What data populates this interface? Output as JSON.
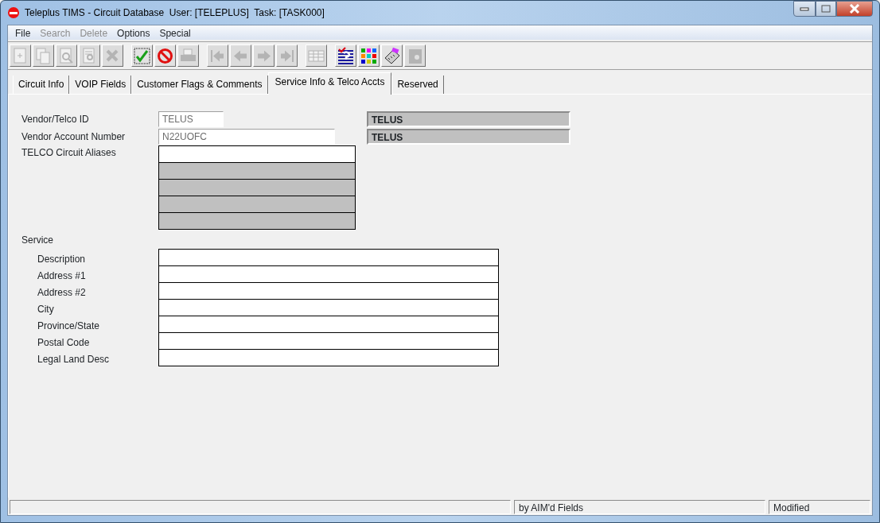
{
  "window": {
    "title": "Teleplus TIMS - Circuit Database  User: [TELEPLUS]  Task: [TASK000]"
  },
  "menu": [
    {
      "label": "File",
      "disabled": false
    },
    {
      "label": "Search",
      "disabled": true
    },
    {
      "label": "Delete",
      "disabled": true
    },
    {
      "label": "Options",
      "disabled": false
    },
    {
      "label": "Special",
      "disabled": false
    }
  ],
  "toolbar": [
    [
      {
        "kind": "new",
        "disabled": true
      },
      {
        "kind": "copy",
        "disabled": true
      },
      {
        "kind": "find",
        "disabled": true
      },
      {
        "kind": "find-doc",
        "disabled": true
      },
      {
        "kind": "delete",
        "disabled": true
      }
    ],
    [
      {
        "kind": "save",
        "disabled": false
      },
      {
        "kind": "cancel",
        "disabled": false
      },
      {
        "kind": "print",
        "disabled": true
      }
    ],
    [
      {
        "kind": "first",
        "disabled": true
      },
      {
        "kind": "prev",
        "disabled": true
      },
      {
        "kind": "next",
        "disabled": true
      },
      {
        "kind": "last",
        "disabled": true
      }
    ],
    [
      {
        "kind": "table",
        "disabled": true
      }
    ],
    [
      {
        "kind": "help",
        "disabled": false
      },
      {
        "kind": "grid",
        "disabled": false
      },
      {
        "kind": "phone",
        "disabled": false
      },
      {
        "kind": "tool",
        "disabled": true
      }
    ]
  ],
  "tabs": [
    {
      "label": "Circuit Info",
      "selected": false
    },
    {
      "label": "VOIP Fields",
      "selected": false
    },
    {
      "label": "Customer Flags & Comments",
      "selected": false
    },
    {
      "label": "Service Info & Telco Accts",
      "selected": true
    },
    {
      "label": "Reserved",
      "selected": false
    }
  ],
  "vendor_id": {
    "label": "Vendor/Telco ID",
    "value": "TELUS",
    "name": "TELUS"
  },
  "vendor_account": {
    "label": "Vendor Account Number",
    "value": "N22UOFC",
    "name": "TELUS"
  },
  "aliases": {
    "label": "TELCO Circuit Aliases",
    "rows": [
      {
        "disabled": false
      },
      {
        "disabled": true
      },
      {
        "disabled": true
      },
      {
        "disabled": true
      },
      {
        "disabled": true
      }
    ]
  },
  "service": {
    "label": "Service",
    "fields": [
      {
        "label": "Description"
      },
      {
        "label": "Address #1"
      },
      {
        "label": "Address #2"
      },
      {
        "label": "City"
      },
      {
        "label": "Province/State"
      },
      {
        "label": "Postal Code"
      },
      {
        "label": "Legal Land Desc"
      }
    ]
  },
  "status_bar": {
    "panel_2": "by AIM'd Fields",
    "panel_3": "Modified"
  }
}
